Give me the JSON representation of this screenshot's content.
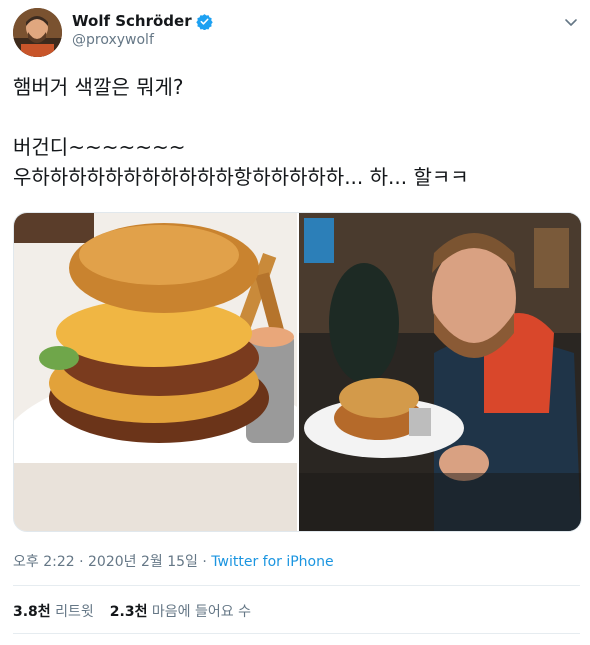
{
  "author": {
    "display_name": "Wolf Schröder",
    "handle": "@proxywolf"
  },
  "icons": {
    "verified": "verified-badge-icon",
    "menu": "chevron-down-icon"
  },
  "tweet": {
    "text": "햄버거 색깔은 뭐게?\n\n버건디~~~~~~~\n우하하하하하하하하하하하항하하하하하... 하... 할ㅋㅋ"
  },
  "meta": {
    "time": "오후 2:22",
    "separator": "·",
    "date": "2020년 2월 15일",
    "source": "Twitter for iPhone"
  },
  "stats": {
    "retweets_count": "3.8천",
    "retweets_label": "리트윗",
    "likes_count": "2.3천",
    "likes_label": "마음에 들어요 수"
  },
  "colors": {
    "link": "#1b95e0",
    "verified": "#1da1f2",
    "secondary_text": "#657786"
  }
}
